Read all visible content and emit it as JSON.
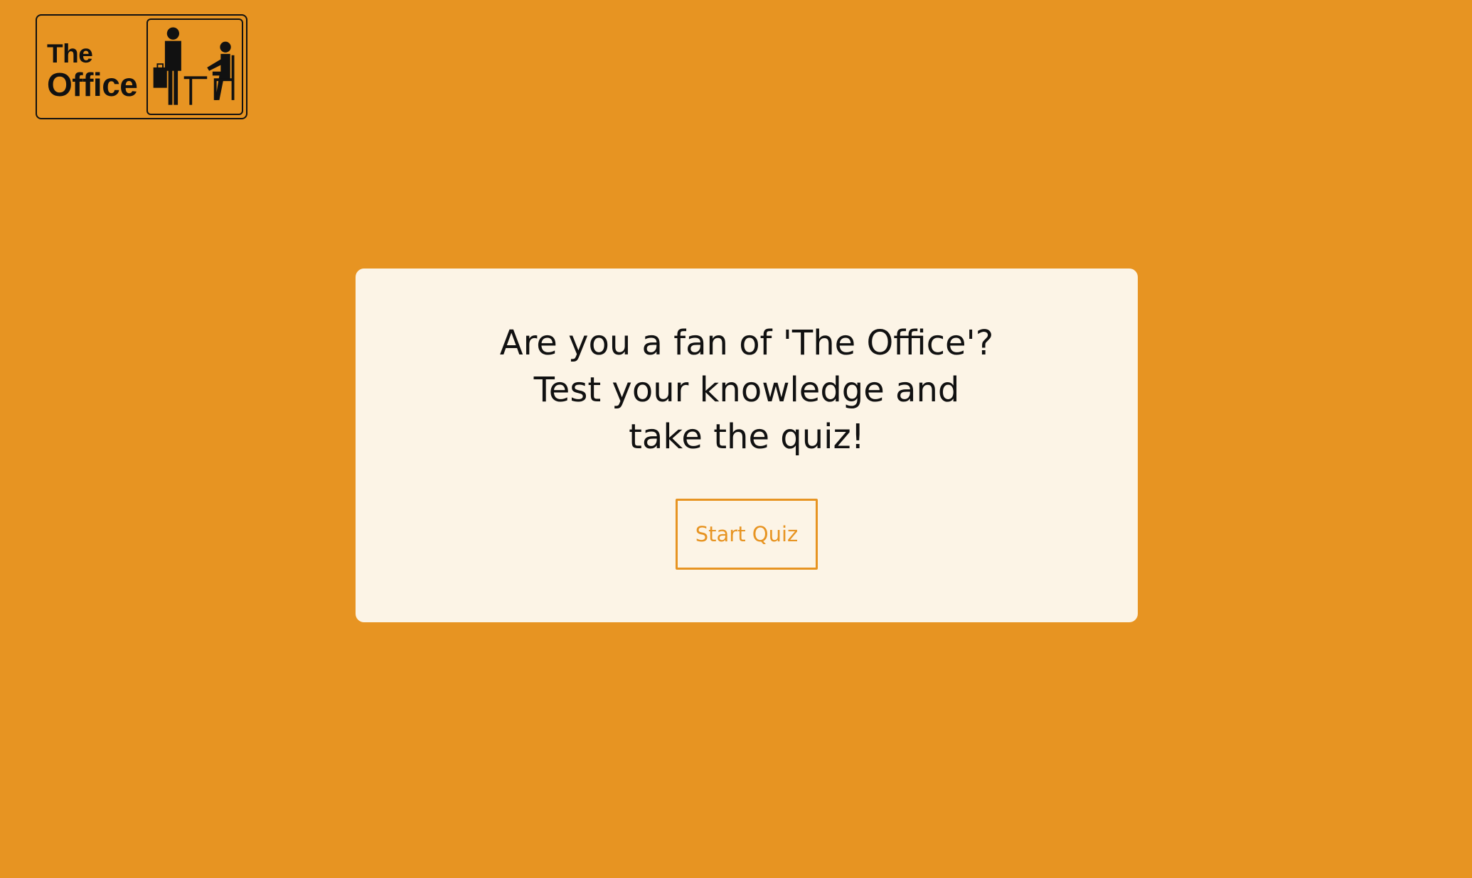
{
  "colors": {
    "background": "#e79422",
    "card": "#fcf4e6",
    "accent": "#e79422",
    "text": "#111111"
  },
  "logo": {
    "line1": "The",
    "line2": "Office",
    "figures_icon": "office-workers-icon"
  },
  "intro": {
    "question": "Are you a fan of 'The Office'? Test your knowledge and take the quiz!",
    "start_label": "Start Quiz"
  }
}
